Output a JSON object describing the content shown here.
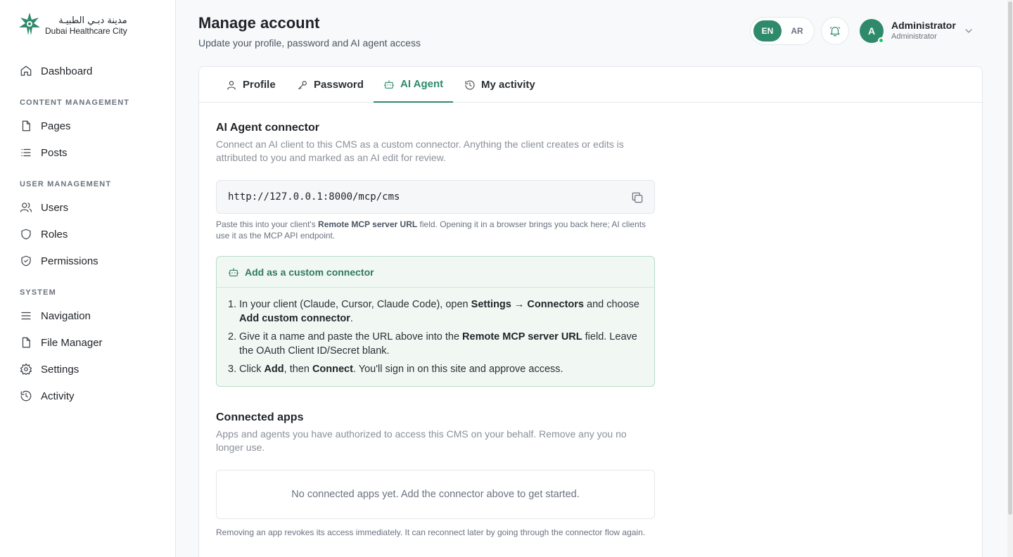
{
  "brand": {
    "name_ar": "مدينة دبـي الطبيـة",
    "name_en": "Dubai Healthcare City",
    "accent": "#2f8a6b"
  },
  "sidebar": {
    "top_items": [
      {
        "label": "Dashboard",
        "icon": "home-icon"
      }
    ],
    "sections": [
      {
        "title": "CONTENT MANAGEMENT",
        "items": [
          {
            "label": "Pages",
            "icon": "file-icon"
          },
          {
            "label": "Posts",
            "icon": "list-icon"
          }
        ]
      },
      {
        "title": "USER MANAGEMENT",
        "items": [
          {
            "label": "Users",
            "icon": "users-icon"
          },
          {
            "label": "Roles",
            "icon": "shield-icon"
          },
          {
            "label": "Permissions",
            "icon": "shield-check-icon"
          }
        ]
      },
      {
        "title": "SYSTEM",
        "items": [
          {
            "label": "Navigation",
            "icon": "menu-icon"
          },
          {
            "label": "File Manager",
            "icon": "file-icon"
          },
          {
            "label": "Settings",
            "icon": "gear-icon"
          },
          {
            "label": "Activity",
            "icon": "history-icon"
          }
        ]
      }
    ]
  },
  "header": {
    "title": "Manage account",
    "subtitle": "Update your profile, password and AI agent access",
    "lang_en": "EN",
    "lang_ar": "AR",
    "user_initial": "A",
    "user_name": "Administrator",
    "user_role": "Administrator"
  },
  "tabs": [
    {
      "label": "Profile",
      "icon": "user-icon",
      "active": false
    },
    {
      "label": "Password",
      "icon": "key-icon",
      "active": false
    },
    {
      "label": "AI Agent",
      "icon": "bot-icon",
      "active": true
    },
    {
      "label": "My activity",
      "icon": "history-icon",
      "active": false
    }
  ],
  "connector": {
    "title": "AI Agent connector",
    "description": "Connect an AI client to this CMS as a custom connector. Anything the client creates or edits is attributed to you and marked as an AI edit for review.",
    "url": "http://127.0.0.1:8000/mcp/cms",
    "hint_pre": "Paste this into your client's ",
    "hint_bold": "Remote MCP server URL",
    "hint_post": " field. Opening it in a browser brings you back here; AI clients use it as the MCP API endpoint.",
    "box_title": "Add as a custom connector",
    "steps": [
      {
        "n": "1.",
        "parts": [
          {
            "t": "In your client (Claude, Cursor, Claude Code), open "
          },
          {
            "t": "Settings → Connectors",
            "b": true
          },
          {
            "t": " and choose "
          },
          {
            "t": "Add custom connector",
            "b": true
          },
          {
            "t": "."
          }
        ]
      },
      {
        "n": "2.",
        "parts": [
          {
            "t": "Give it a name and paste the URL above into the "
          },
          {
            "t": "Remote MCP server URL",
            "b": true
          },
          {
            "t": " field. Leave the OAuth Client ID/Secret blank."
          }
        ]
      },
      {
        "n": "3.",
        "parts": [
          {
            "t": "Click "
          },
          {
            "t": "Add",
            "b": true
          },
          {
            "t": ", then "
          },
          {
            "t": "Connect",
            "b": true
          },
          {
            "t": ". You'll sign in on this site and approve access."
          }
        ]
      }
    ]
  },
  "connected_apps": {
    "title": "Connected apps",
    "description": "Apps and agents you have authorized to access this CMS on your behalf. Remove any you no longer use.",
    "empty_text": "No connected apps yet. Add the connector above to get started.",
    "footnote": "Removing an app revokes its access immediately. It can reconnect later by going through the connector flow again."
  }
}
